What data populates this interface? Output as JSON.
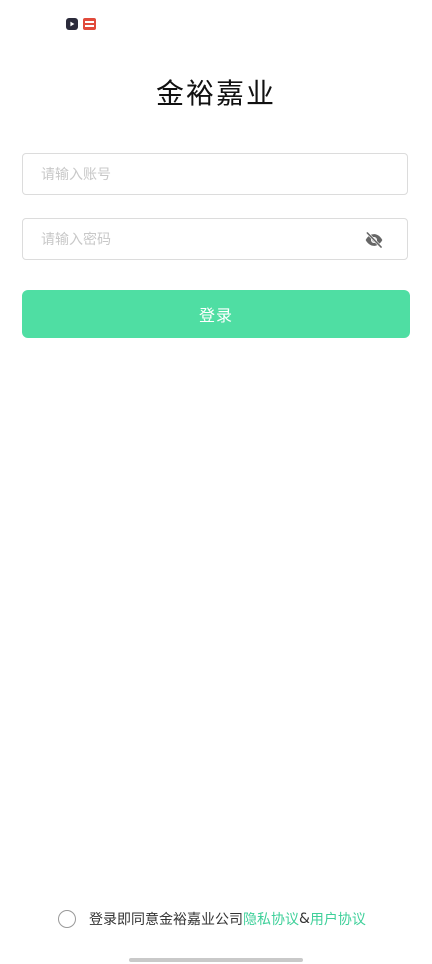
{
  "status_bar": {
    "icons": [
      "video-app-icon",
      "news-app-icon"
    ]
  },
  "header": {
    "title": "金裕嘉业"
  },
  "form": {
    "account_placeholder": "请输入账号",
    "account_value": "",
    "password_placeholder": "请输入密码",
    "password_value": "",
    "eye_icon": "eye-off-icon",
    "login_label": "登录"
  },
  "agreement": {
    "checked": false,
    "prefix": "登录即同意金裕嘉业公司 ",
    "privacy_label": "隐私协议",
    "ampersand": "&",
    "user_label": "用户协议"
  },
  "colors": {
    "accent": "#4fdea3",
    "link": "#3fd09a",
    "border": "#dcdcdc",
    "placeholder": "#c8c8c8"
  }
}
